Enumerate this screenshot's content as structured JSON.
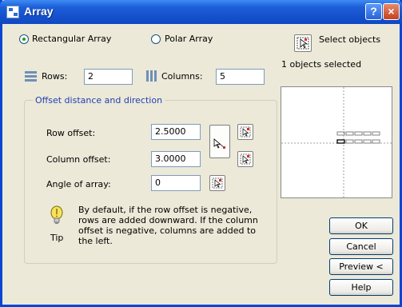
{
  "window": {
    "title": "Array",
    "help_glyph": "?",
    "close_glyph": "×"
  },
  "mode": {
    "rectangular_label": "Rectangular Array",
    "polar_label": "Polar Array",
    "selected": "rectangular"
  },
  "select_objects": {
    "label": "Select objects",
    "status": "1 objects selected"
  },
  "grid": {
    "rows_label": "Rows:",
    "rows_value": "2",
    "columns_label": "Columns:",
    "columns_value": "5"
  },
  "offset_group": {
    "title": "Offset distance and direction",
    "row_offset_label": "Row offset:",
    "row_offset_value": "2.5000",
    "column_offset_label": "Column offset:",
    "column_offset_value": "3.0000",
    "angle_label": "Angle of array:",
    "angle_value": "0"
  },
  "tip": {
    "label": "Tip",
    "text": "By default, if the row offset is negative, rows are added downward.  If the column offset is negative, columns are added to the left."
  },
  "buttons": {
    "ok": "OK",
    "cancel": "Cancel",
    "preview": "Preview <",
    "help": "Help"
  },
  "colors": {
    "titlebar": "#1550cc",
    "dialog_bg": "#ece9d8",
    "group_title": "#1f3fb2",
    "radio_dot": "#21a121"
  }
}
